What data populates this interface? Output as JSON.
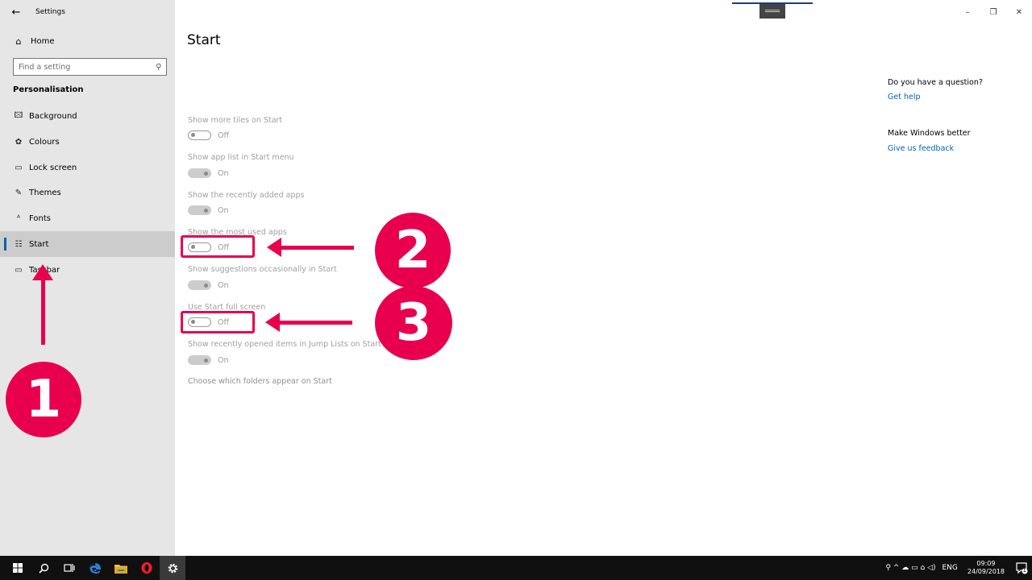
{
  "window": {
    "back_icon": "←",
    "title": "Settings",
    "controls": {
      "minimize": "–",
      "restore": "❐",
      "close": "✕"
    },
    "drag_handle": "═══"
  },
  "sidebar": {
    "home": {
      "icon": "⌂",
      "label": "Home"
    },
    "search": {
      "placeholder": "Find a setting",
      "icon": "⚲"
    },
    "section": "Personalisation",
    "items": [
      {
        "icon": "🖾",
        "label": "Background",
        "active": false
      },
      {
        "icon": "✿",
        "label": "Colours",
        "active": false
      },
      {
        "icon": "▭",
        "label": "Lock screen",
        "active": false
      },
      {
        "icon": "✎",
        "label": "Themes",
        "active": false
      },
      {
        "icon": "ᴬ",
        "label": "Fonts",
        "active": false
      },
      {
        "icon": "☷",
        "label": "Start",
        "active": true
      },
      {
        "icon": "▭",
        "label": "Taskbar",
        "active": false
      }
    ]
  },
  "main": {
    "title": "Start",
    "settings": [
      {
        "label": "Show more tiles on Start",
        "state": "Off"
      },
      {
        "label": "Show app list in Start menu",
        "state": "On"
      },
      {
        "label": "Show the recently added apps",
        "state": "On"
      },
      {
        "label": "Show the most used apps",
        "state": "Off"
      },
      {
        "label": "Show suggestions occasionally in Start",
        "state": "On"
      },
      {
        "label": "Use Start full screen",
        "state": "Off"
      },
      {
        "label": "Show recently opened items in Jump Lists on Start or the taskbar",
        "state": "On"
      }
    ],
    "folders_link": "Choose which folders appear on Start"
  },
  "help": {
    "question_heading": "Do you have a question?",
    "get_help": "Get help",
    "better_heading": "Make Windows better",
    "feedback": "Give us feedback"
  },
  "annotations": {
    "badge1": "1",
    "badge2": "2",
    "badge3": "3",
    "color": "#e8004f"
  },
  "taskbar": {
    "icons": [
      "windows-start-icon",
      "search-icon",
      "task-view-icon",
      "edge-icon",
      "file-explorer-icon",
      "opera-icon",
      "settings-icon"
    ],
    "tray_icons": "⚲ ^ ☁ ▭ ⌂ ◁)",
    "language": "ENG",
    "time": "09:09",
    "date": "24/09/2018",
    "notification_count": "1"
  }
}
